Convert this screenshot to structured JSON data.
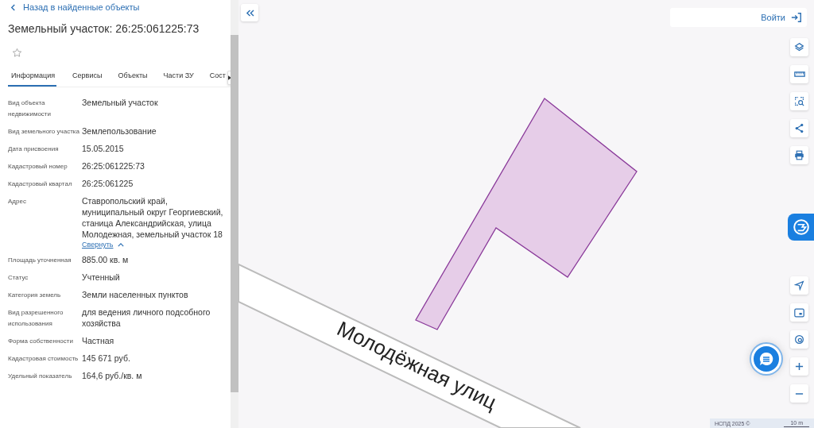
{
  "panel": {
    "back_link": "Назад в найденные объекты",
    "title": "Земельный участок: 26:25:061225:73",
    "tabs": [
      {
        "label": "Информация",
        "selected": true
      },
      {
        "label": "Сервисы",
        "selected": false
      },
      {
        "label": "Объекты",
        "selected": false
      },
      {
        "label": "Части ЗУ",
        "selected": false
      },
      {
        "label": "Сост",
        "selected": false
      }
    ],
    "fields": [
      {
        "label": "Вид объекта недвижимости",
        "value": "Земельный участок"
      },
      {
        "label": "Вид земельного участка",
        "value": "Землепользование"
      },
      {
        "label": "Дата присвоения",
        "value": "15.05.2015"
      },
      {
        "label": "Кадастровый номер",
        "value": "26:25:061225:73"
      },
      {
        "label": "Кадастровый квартал",
        "value": "26:25:061225"
      },
      {
        "label": "Адрес",
        "value": "Ставропольский край, муниципальный округ Георгиевский, станица Александрийская, улица Молодежная, земельный участок 18",
        "link": "Свернуть"
      },
      {
        "label": "Площадь уточненная",
        "value": "885.00 кв. м"
      },
      {
        "label": "Статус",
        "value": "Учтенный"
      },
      {
        "label": "Категория земель",
        "value": "Земли населенных пунктов"
      },
      {
        "label": "Вид разрешенного использования",
        "value": "для ведения личного подсобного хозяйства"
      },
      {
        "label": "Форма собственности",
        "value": "Частная"
      },
      {
        "label": "Кадастровая стоимость",
        "value": "145 671 руб."
      },
      {
        "label": "Удельный показатель",
        "value": "164,6 руб./кв. м"
      }
    ]
  },
  "map": {
    "login_button": "Войти",
    "street_label": "Молодёжная  улиц",
    "attribution": "НСПД 2025 ©",
    "scale_label": "10 m"
  }
}
